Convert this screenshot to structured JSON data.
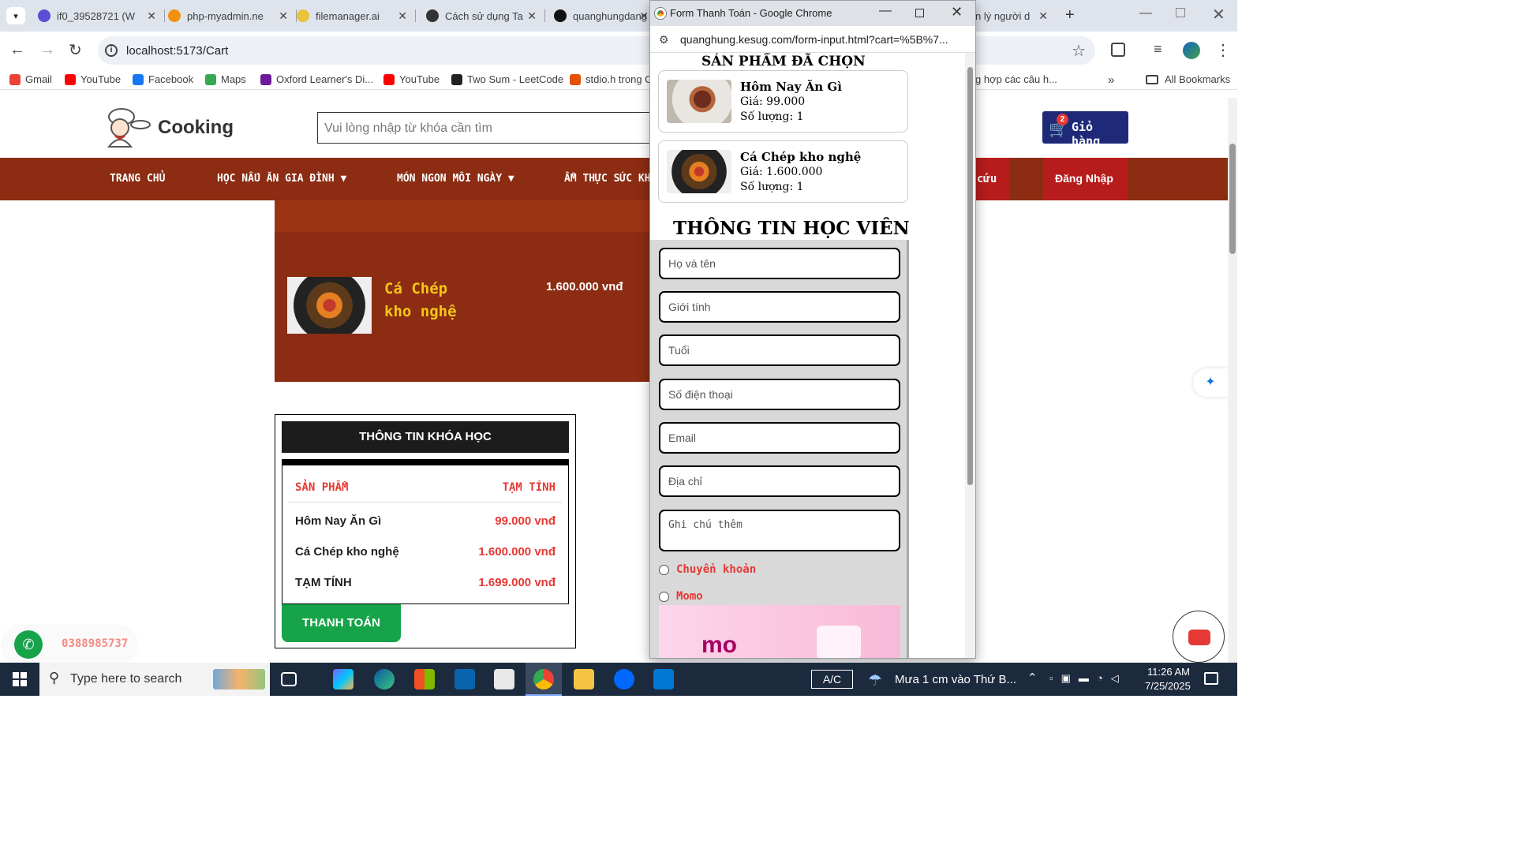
{
  "browser": {
    "tabs": [
      {
        "label": "if0_39528721 (W",
        "icon": "infinity-icon",
        "color": "#5b4dd6"
      },
      {
        "label": "php-myadmin.ne",
        "icon": "phpmyadmin-icon",
        "color": "#f29111"
      },
      {
        "label": "filemanager.ai",
        "icon": "filemanager-icon",
        "color": "#e8c33b"
      },
      {
        "label": "Cách sử dụng Ta",
        "icon": "openai-icon",
        "color": "#333333"
      },
      {
        "label": "quanghungdang",
        "icon": "github-icon",
        "color": "#111111"
      },
      {
        "label": "n lý người d",
        "icon": "page-icon",
        "color": "#888888"
      }
    ],
    "url": "localhost:5173/Cart",
    "bookmarks": [
      {
        "label": "Gmail",
        "color": "#ea4335"
      },
      {
        "label": "YouTube",
        "color": "#ff0000"
      },
      {
        "label": "Facebook",
        "color": "#1877f2"
      },
      {
        "label": "Maps",
        "color": "#34a853"
      },
      {
        "label": "Oxford Learner's Di...",
        "color": "#6a1b9a"
      },
      {
        "label": "YouTube",
        "color": "#ff0000"
      },
      {
        "label": "Two Sum - LeetCode",
        "color": "#222222"
      },
      {
        "label": "stdio.h trong C",
        "color": "#e65100"
      },
      {
        "label": "g hợp các câu h...",
        "color": "#ffffff"
      }
    ],
    "all_bookmarks": "All Bookmarks",
    "more_bookmarks": "»"
  },
  "site": {
    "logo_text": "Cooking",
    "search_placeholder": "Vui lòng nhập từ khóa cần tìm",
    "cart_label": "Giỏ hàng",
    "cart_count": "2",
    "nav": [
      "TRANG CHỦ",
      "HỌC NẤU ĂN GIA ĐÌNH ▼",
      "MÓN NGON MỖI NGÀY ▼",
      "ẨM THỰC SỨC KH"
    ],
    "nav_partial": "cứu",
    "login": "Đăng Nhập",
    "cart_item": {
      "name_line1": "Cá Chép",
      "name_line2": "kho nghệ",
      "price": "1.600.000 vnđ"
    },
    "course_info": {
      "title": "THÔNG TIN KHÓA HỌC",
      "col_product": "SẢN PHẨM",
      "col_subtotal": "TẠM TÍNH",
      "rows": [
        {
          "name": "Hôm Nay Ăn Gì",
          "price": "99.000 vnđ"
        },
        {
          "name": "Cá Chép kho nghệ",
          "price": "1.600.000 vnđ"
        }
      ],
      "total_label": "TẠM TÍNH",
      "total_value": "1.699.000 vnđ",
      "pay_button": "THANH TOÁN"
    },
    "phone": "0388985737"
  },
  "popup": {
    "title": "Form Thanh Toán - Google Chrome",
    "url": "quanghung.kesug.com/form-input.html?cart=%5B%7...",
    "selected_heading": "SẢN PHẨM ĐÃ CHỌN",
    "items": [
      {
        "name": "Hôm Nay Ăn Gì",
        "price": "Giá: 99.000",
        "qty": "Số lượng: 1"
      },
      {
        "name": "Cá Chép kho nghệ",
        "price": "Giá: 1.600.000",
        "qty": "Số lượng: 1"
      }
    ],
    "student_heading": "THÔNG TIN HỌC VIÊN",
    "fields": [
      "Họ và tên",
      "Giới tính",
      "Tuổi",
      "Số điện thoại",
      "Email",
      "Địa chỉ"
    ],
    "notes_placeholder": "Ghi chú thêm",
    "payment_options": [
      "Chuyển khoản",
      "Momo"
    ],
    "momo_logo": "mo"
  },
  "taskbar": {
    "search_placeholder": "Type here to search",
    "ime": "A/C",
    "weather": "Mưa 1 cm vào Thứ B...",
    "time": "11:26 AM",
    "date": "7/25/2025"
  }
}
